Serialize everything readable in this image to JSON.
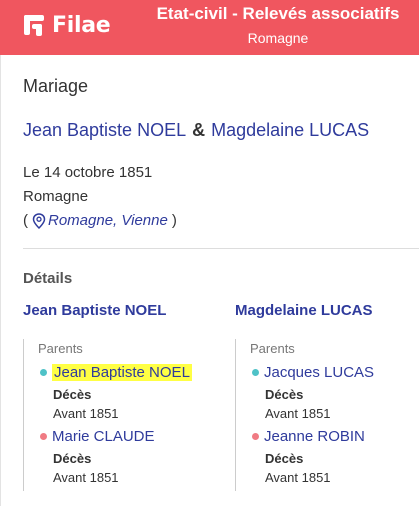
{
  "header": {
    "brand": "Filae",
    "title": "Etat-civil - Relevés associatifs",
    "subtitle": "Romagne",
    "color": "#f0565f"
  },
  "record": {
    "type": "Mariage",
    "spouse1": "Jean Baptiste NOEL",
    "connector": "&",
    "spouse2": "Magdelaine LUCAS",
    "date": "Le 14 octobre 1851",
    "commune": "Romagne",
    "location_open": "(",
    "location": "Romagne, Vienne",
    "location_close": ")"
  },
  "details": {
    "title": "Détails",
    "left": {
      "name": "Jean Baptiste NOEL",
      "parents_label": "Parents",
      "father": {
        "name": "Jean Baptiste NOEL",
        "event": "Décès",
        "when": "Avant 1851",
        "highlighted": true
      },
      "mother": {
        "name": "Marie CLAUDE",
        "event": "Décès",
        "when": "Avant 1851"
      }
    },
    "right": {
      "name": "Magdelaine LUCAS",
      "parents_label": "Parents",
      "father": {
        "name": "Jacques LUCAS",
        "event": "Décès",
        "when": "Avant 1851"
      },
      "mother": {
        "name": "Jeanne ROBIN",
        "event": "Décès",
        "when": "Avant 1851"
      }
    }
  },
  "colors": {
    "link": "#2f3b9c",
    "male_dot": "#4fc2c7",
    "female_dot": "#f07b83",
    "highlight": "#ffff44"
  }
}
